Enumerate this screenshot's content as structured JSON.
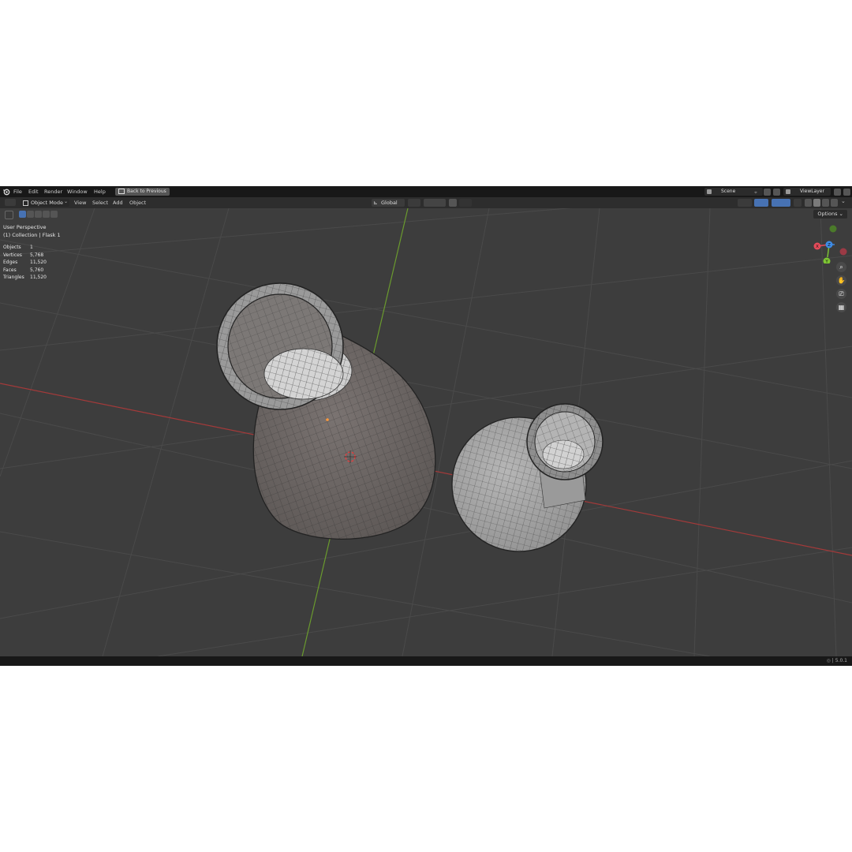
{
  "menu": {
    "file": "File",
    "edit": "Edit",
    "render": "Render",
    "window": "Window",
    "help": "Help",
    "back_to_previous": "Back to Previous"
  },
  "scene": {
    "label": "Scene",
    "view_layer": "ViewLayer"
  },
  "header": {
    "mode": "Object Mode",
    "view": "View",
    "select": "Select",
    "add": "Add",
    "object": "Object",
    "orientation": "Global",
    "options": "Options"
  },
  "overlay": {
    "perspective": "User Perspective",
    "collection": "(1) Collection | Flask 1"
  },
  "stats": [
    {
      "label": "Objects",
      "value": "1"
    },
    {
      "label": "Vertices",
      "value": "5,768"
    },
    {
      "label": "Edges",
      "value": "11,520"
    },
    {
      "label": "Faces",
      "value": "5,760"
    },
    {
      "label": "Triangles",
      "value": "11,520"
    }
  ],
  "gizmo": {
    "x": "X",
    "y": "Y",
    "z": "Z"
  },
  "status": {
    "version": "5.0.1"
  },
  "colors": {
    "x_axis": "#e54b5a",
    "y_axis": "#7ec633",
    "z_axis": "#3e8de8",
    "viewport_bg": "#3d3d3d"
  }
}
